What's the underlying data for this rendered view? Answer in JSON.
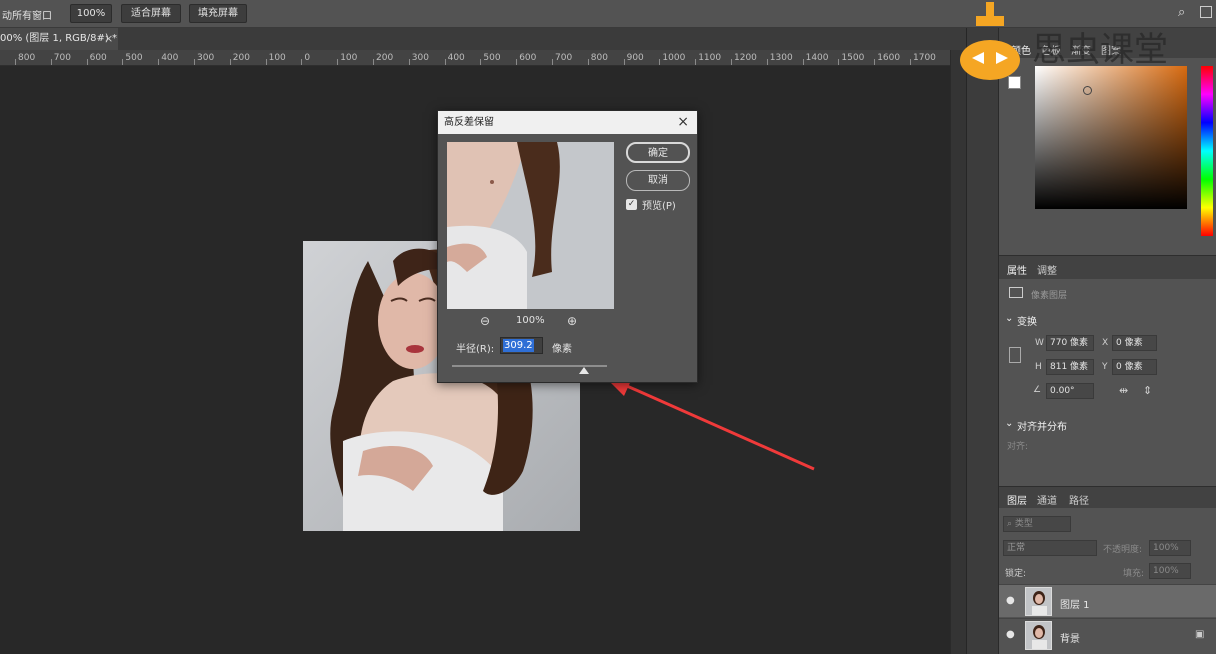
{
  "options_bar": {
    "scroll_all_label": "动所有窗口",
    "zoom_100_label": "100%",
    "fit_screen_label": "适合屏幕",
    "fill_screen_label": "填充屏幕"
  },
  "document_tab": {
    "title": "00% (图层 1, RGB/8#) *",
    "close": "×"
  },
  "ruler": {
    "labels": [
      "800",
      "700",
      "600",
      "500",
      "400",
      "300",
      "200",
      "100",
      "0",
      "100",
      "200",
      "300",
      "400",
      "500",
      "600",
      "700",
      "800",
      "900",
      "1000",
      "1100",
      "1200",
      "1300",
      "1400",
      "1500",
      "1600",
      "1700"
    ]
  },
  "dialog": {
    "title": "高反差保留",
    "close": "×",
    "ok_label": "确定",
    "cancel_label": "取消",
    "preview_label": "预览(P)",
    "preview_checked": "✓",
    "zoom_percent": "100%",
    "zoom_out": "⊖",
    "zoom_in": "⊕",
    "radius_label": "半径(R):",
    "radius_value": "309.2",
    "radius_unit": "像素"
  },
  "watermark": {
    "text": "思虫课堂"
  },
  "color_panel": {
    "tabs": [
      "颜色",
      "色板",
      "渐变",
      "图案"
    ]
  },
  "properties_panel": {
    "tabs": [
      "属性",
      "调整"
    ],
    "layer_type": "像素图层",
    "transform_title": "变换",
    "w_label": "W",
    "w_value": "770 像素",
    "h_label": "H",
    "h_value": "811 像素",
    "x_label": "X",
    "x_value": "0 像素",
    "y_label": "Y",
    "y_value": "0 像素",
    "angle_value": "0.00°",
    "align_title": "对齐并分布",
    "align_label": "对齐:"
  },
  "layers_panel": {
    "tabs": [
      "图层",
      "通道",
      "路径"
    ],
    "filter_placeholder": "类型",
    "blend_mode": "正常",
    "opacity_label": "不透明度:",
    "opacity_value": "100%",
    "lock_label": "锁定:",
    "fill_label": "填充:",
    "fill_value": "100%",
    "layers": [
      {
        "name": "图层 1",
        "visible": "●"
      },
      {
        "name": "背景",
        "visible": "●"
      }
    ]
  },
  "colors": {
    "accent_red": "#f03a3a",
    "selection_blue": "#2f6fd6",
    "hue_color": "#d76a10"
  }
}
